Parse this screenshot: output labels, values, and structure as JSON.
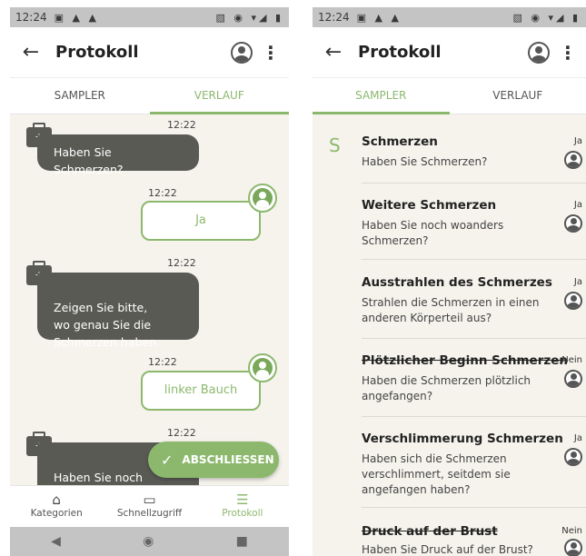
{
  "status": {
    "time": "12:24",
    "left_icons": "▣ ▲ ▲",
    "right_icons": "▧ ◉ ▾◢ ▮"
  },
  "appbar": {
    "title": "Protokoll"
  },
  "tabs": [
    {
      "label": "SAMPLER"
    },
    {
      "label": "VERLAUF"
    }
  ],
  "phone1": {
    "active_tab": "VERLAUF",
    "messages": [
      {
        "time": "12:22",
        "from": "system",
        "text": "Haben Sie Schmerzen?"
      },
      {
        "time": "12:22",
        "from": "user",
        "text": "Ja"
      },
      {
        "time": "12:22",
        "from": "system",
        "text": "Zeigen Sie bitte,\nwo genau Sie die\nSchmerzen haben."
      },
      {
        "time": "12:22",
        "from": "user",
        "text": "linker Bauch"
      },
      {
        "time": "12:22",
        "from": "system",
        "text": "Haben Sie noch\nwoanders Schmer"
      }
    ],
    "fab_label": "ABSCHLIESSEN",
    "bottom_nav": [
      {
        "label": "Kategorien",
        "icon": "home-icon"
      },
      {
        "label": "Schnellzugriff",
        "icon": "chat-icon"
      },
      {
        "label": "Protokoll",
        "icon": "list-check-icon"
      }
    ]
  },
  "phone2": {
    "active_tab": "SAMPLER",
    "section_letter": "S",
    "items": [
      {
        "title": "Schmerzen",
        "question": "Haben Sie Schmerzen?",
        "answer": "Ja",
        "strike": false
      },
      {
        "title": "Weitere Schmerzen",
        "question": "Haben Sie noch woanders Schmerzen?",
        "answer": "Ja",
        "strike": false
      },
      {
        "title": "Ausstrahlen des Schmerzes",
        "question": "Strahlen die Schmerzen in einen anderen Körperteil aus?",
        "answer": "Ja",
        "strike": false
      },
      {
        "title": "Plötzlicher Beginn Schmerzen",
        "question": "Haben die Schmerzen plötzlich angefangen?",
        "answer": "Nein",
        "strike": true
      },
      {
        "title": "Verschlimmerung Schmerzen",
        "question": "Haben sich die Schmerzen verschlimmert, seitdem sie angefangen haben?",
        "answer": "Ja",
        "strike": false
      },
      {
        "title": "Druck auf der Brust",
        "question": "Haben Sie Druck auf der Brust?",
        "answer": "Nein",
        "strike": true
      }
    ]
  },
  "colors": {
    "accent": "#8cb86d",
    "bubble": "#5a5a55",
    "background": "#f5f3ec"
  }
}
